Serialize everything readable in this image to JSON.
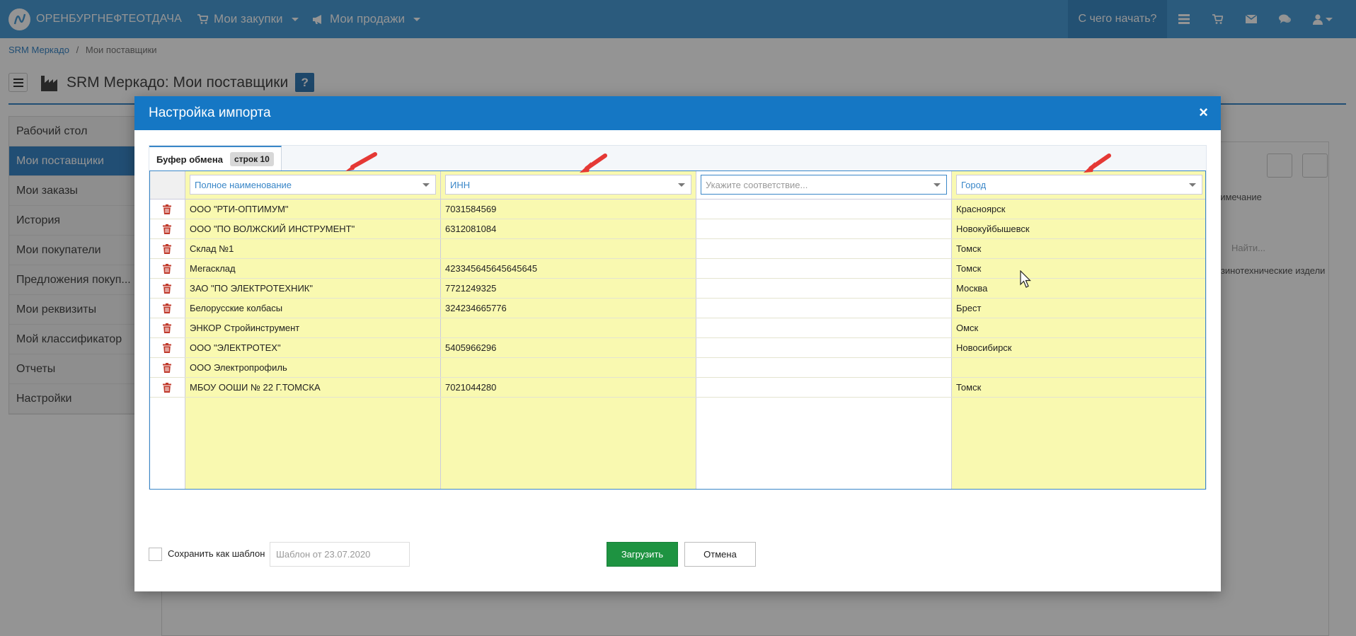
{
  "navbar": {
    "brand": "ОРЕНБУРГНЕФТЕОТДАЧА",
    "purchases": "Мои закупки",
    "sales": "Мои продажи",
    "start": "С чего начать?",
    "icons": [
      "list-icon",
      "cart-icon",
      "envelope-icon",
      "comments-icon",
      "user-icon"
    ]
  },
  "breadcrumb": {
    "root": "SRM Меркадо",
    "separator": "/",
    "current": "Мои поставщики"
  },
  "page": {
    "title": "SRM Меркадо: Мои поставщики",
    "help": "?"
  },
  "sidebar": {
    "items": [
      {
        "label": "Рабочий стол"
      },
      {
        "label": "Мои поставщики"
      },
      {
        "label": "Мои заказы"
      },
      {
        "label": "История"
      },
      {
        "label": "Мои покупатели"
      },
      {
        "label": "Предложения покуп..."
      },
      {
        "label": "Мои реквизиты"
      },
      {
        "label": "Мой классификатор"
      },
      {
        "label": "Отчеты"
      },
      {
        "label": "Настройки"
      }
    ]
  },
  "background": {
    "note_header": "римечание",
    "filter_placeholder": "Найти...",
    "cell": "езинотехнические издели"
  },
  "modal": {
    "title": "Настройка импорта",
    "close": "×",
    "tab": {
      "label": "Буфер обмена",
      "badge": "строк 10"
    },
    "columns": [
      {
        "value": "Полное наименование",
        "placeholder": false
      },
      {
        "value": "ИНН",
        "placeholder": false
      },
      {
        "value": "Укажите соответствие...",
        "placeholder": true
      },
      {
        "value": "Город",
        "placeholder": false
      }
    ],
    "rows": [
      [
        "ООО \"РТИ-ОПТИМУМ\"",
        "7031584569",
        "",
        "Красноярск"
      ],
      [
        "ООО \"ПО ВОЛЖСКИЙ ИНСТРУМЕНТ\"",
        "6312081084",
        "",
        "Новокуйбышевск"
      ],
      [
        "Склад №1",
        "",
        "",
        "Томск"
      ],
      [
        "Мегасклад",
        "423345645645645645",
        "",
        "Томск"
      ],
      [
        "ЗАО \"ПО ЭЛЕКТРОТЕХНИК\"",
        "7721249325",
        "",
        "Москва"
      ],
      [
        "Белорусские колбасы",
        "324234665776",
        "",
        "Брест"
      ],
      [
        "ЭНКОР Стройинструмент",
        "",
        "",
        "Омск"
      ],
      [
        "ООО \"ЭЛЕКТРОТЕХ\"",
        "5405966296",
        "",
        "Новосибирск"
      ],
      [
        "ООО Электропрофиль",
        "",
        "",
        ""
      ],
      [
        "МБОУ ООШИ № 22 Г.ТОМСКА",
        "7021044280",
        "",
        "Томск"
      ]
    ],
    "footer": {
      "save_template": "Сохранить как шаблон",
      "template_placeholder": "Шаблон от 23.07.2020",
      "load": "Загрузить",
      "cancel": "Отмена"
    }
  },
  "colors": {
    "navbar": "#4a9ed8",
    "modal_header": "#1577c4",
    "mapped_column": "#f9f9b0",
    "load_button": "#1e9341",
    "arrow": "#e53935"
  }
}
